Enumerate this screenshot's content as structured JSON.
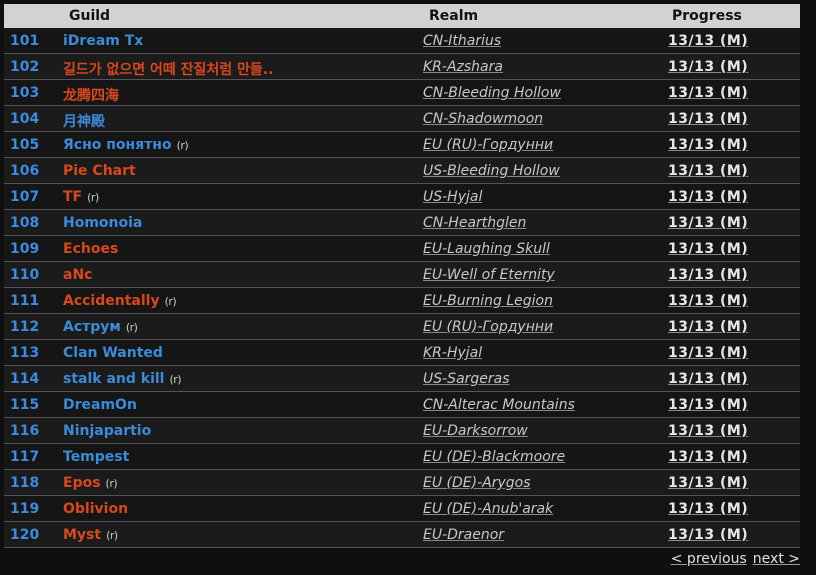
{
  "headers": {
    "guild": "Guild",
    "realm": "Realm",
    "progress": "Progress"
  },
  "recruit_mark": "(r)",
  "pager": {
    "previous": "< previous",
    "next": "next >"
  },
  "colors": {
    "alliance": "#3b8bd8",
    "horde": "#d9481c",
    "rank": "#3d8be0"
  },
  "rows": [
    {
      "rank": "101",
      "guild": "iDream Tx",
      "faction": "alliance",
      "recruiting": false,
      "realm": "CN-Itharius",
      "progress": "13/13 (M)"
    },
    {
      "rank": "102",
      "guild": "길드가 없으면 어떼 잔질처럼 만들..",
      "faction": "horde",
      "recruiting": false,
      "realm": "KR-Azshara",
      "progress": "13/13 (M)"
    },
    {
      "rank": "103",
      "guild": "龙腾四海",
      "faction": "horde",
      "recruiting": false,
      "realm": "CN-Bleeding Hollow",
      "progress": "13/13 (M)"
    },
    {
      "rank": "104",
      "guild": "月神殿",
      "faction": "alliance",
      "recruiting": false,
      "realm": "CN-Shadowmoon",
      "progress": "13/13 (M)"
    },
    {
      "rank": "105",
      "guild": "Ясно понятно",
      "faction": "alliance",
      "recruiting": true,
      "realm": "EU (RU)-Гордунни",
      "progress": "13/13 (M)"
    },
    {
      "rank": "106",
      "guild": "Pie Chart",
      "faction": "horde",
      "recruiting": false,
      "realm": "US-Bleeding Hollow",
      "progress": "13/13 (M)"
    },
    {
      "rank": "107",
      "guild": "TF",
      "faction": "horde",
      "recruiting": true,
      "realm": "US-Hyjal",
      "progress": "13/13 (M)"
    },
    {
      "rank": "108",
      "guild": "Homonoia",
      "faction": "alliance",
      "recruiting": false,
      "realm": "CN-Hearthglen",
      "progress": "13/13 (M)"
    },
    {
      "rank": "109",
      "guild": "Echoes",
      "faction": "horde",
      "recruiting": false,
      "realm": "EU-Laughing Skull",
      "progress": "13/13 (M)"
    },
    {
      "rank": "110",
      "guild": "aNc",
      "faction": "horde",
      "recruiting": false,
      "realm": "EU-Well of Eternity",
      "progress": "13/13 (M)"
    },
    {
      "rank": "111",
      "guild": "Accidentally",
      "faction": "horde",
      "recruiting": true,
      "realm": "EU-Burning Legion",
      "progress": "13/13 (M)"
    },
    {
      "rank": "112",
      "guild": "Аструм",
      "faction": "alliance",
      "recruiting": true,
      "realm": "EU (RU)-Гордунни",
      "progress": "13/13 (M)"
    },
    {
      "rank": "113",
      "guild": "Clan Wanted",
      "faction": "alliance",
      "recruiting": false,
      "realm": "KR-Hyjal",
      "progress": "13/13 (M)"
    },
    {
      "rank": "114",
      "guild": "stalk and kill",
      "faction": "alliance",
      "recruiting": true,
      "realm": "US-Sargeras",
      "progress": "13/13 (M)"
    },
    {
      "rank": "115",
      "guild": "DreamOn",
      "faction": "alliance",
      "recruiting": false,
      "realm": "CN-Alterac Mountains",
      "progress": "13/13 (M)"
    },
    {
      "rank": "116",
      "guild": "Ninjapartio",
      "faction": "alliance",
      "recruiting": false,
      "realm": "EU-Darksorrow",
      "progress": "13/13 (M)"
    },
    {
      "rank": "117",
      "guild": "Tempest",
      "faction": "alliance",
      "recruiting": false,
      "realm": "EU (DE)-Blackmoore",
      "progress": "13/13 (M)"
    },
    {
      "rank": "118",
      "guild": "Epos",
      "faction": "horde",
      "recruiting": true,
      "realm": "EU (DE)-Arygos",
      "progress": "13/13 (M)"
    },
    {
      "rank": "119",
      "guild": "Oblivion",
      "faction": "horde",
      "recruiting": false,
      "realm": "EU (DE)-Anub'arak",
      "progress": "13/13 (M)"
    },
    {
      "rank": "120",
      "guild": "Myst",
      "faction": "horde",
      "recruiting": true,
      "realm": "EU-Draenor",
      "progress": "13/13 (M)"
    }
  ]
}
